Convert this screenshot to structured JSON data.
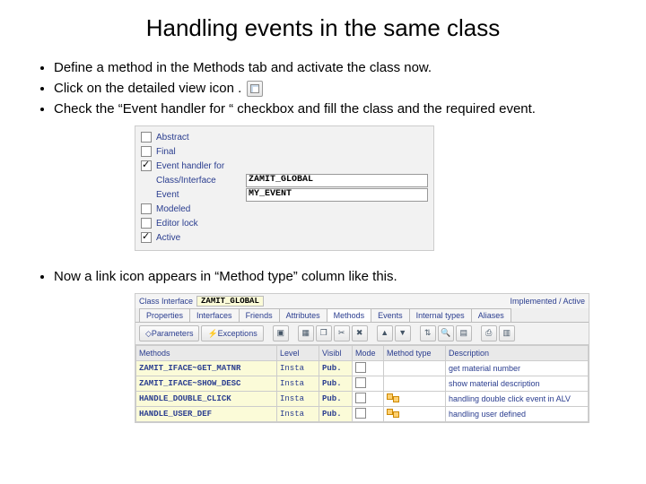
{
  "title": "Handling events in the same class",
  "bullets": {
    "a": "Define a method in the Methods tab and activate the class now.",
    "b_pre": "Click on the detailed view icon .",
    "c": "Check the “Event handler for “ checkbox and fill the class and the required event.",
    "d": "Now a link icon appears in “Method type” column like this."
  },
  "props": {
    "abstract": "Abstract",
    "final": "Final",
    "handler": "Event handler for",
    "classif": "Class/Interface",
    "classif_val": "ZAMIT_GLOBAL",
    "event": "Event",
    "event_val": "MY_EVENT",
    "modeled": "Modeled",
    "editlock": "Editor lock",
    "active": "Active"
  },
  "builder": {
    "classif_label": "Class Interface",
    "classif_val": "ZAMIT_GLOBAL",
    "status": "Implemented / Active",
    "tabs": [
      "Properties",
      "Interfaces",
      "Friends",
      "Attributes",
      "Methods",
      "Events",
      "Internal types",
      "Aliases"
    ],
    "active_tab": 4,
    "secondary": {
      "params": "Parameters",
      "exc": "Exceptions"
    },
    "cols": [
      "Methods",
      "Level",
      "Visibl",
      "Mode",
      "Method type",
      "Description"
    ],
    "rows": [
      {
        "m": "ZAMIT_IFACE~GET_MATNR",
        "lv": "Insta",
        "vi": "Pub.",
        "mt": "",
        "d": "get material number"
      },
      {
        "m": "ZAMIT_IFACE~SHOW_DESC",
        "lv": "Insta",
        "vi": "Pub.",
        "mt": "",
        "d": "show material description"
      },
      {
        "m": "HANDLE_DOUBLE_CLICK",
        "lv": "Insta",
        "vi": "Pub.",
        "mt": "link",
        "d": "handling double click event in ALV"
      },
      {
        "m": "HANDLE_USER_DEF",
        "lv": "Insta",
        "vi": "Pub.",
        "mt": "link",
        "d": "handling user defined"
      }
    ]
  }
}
